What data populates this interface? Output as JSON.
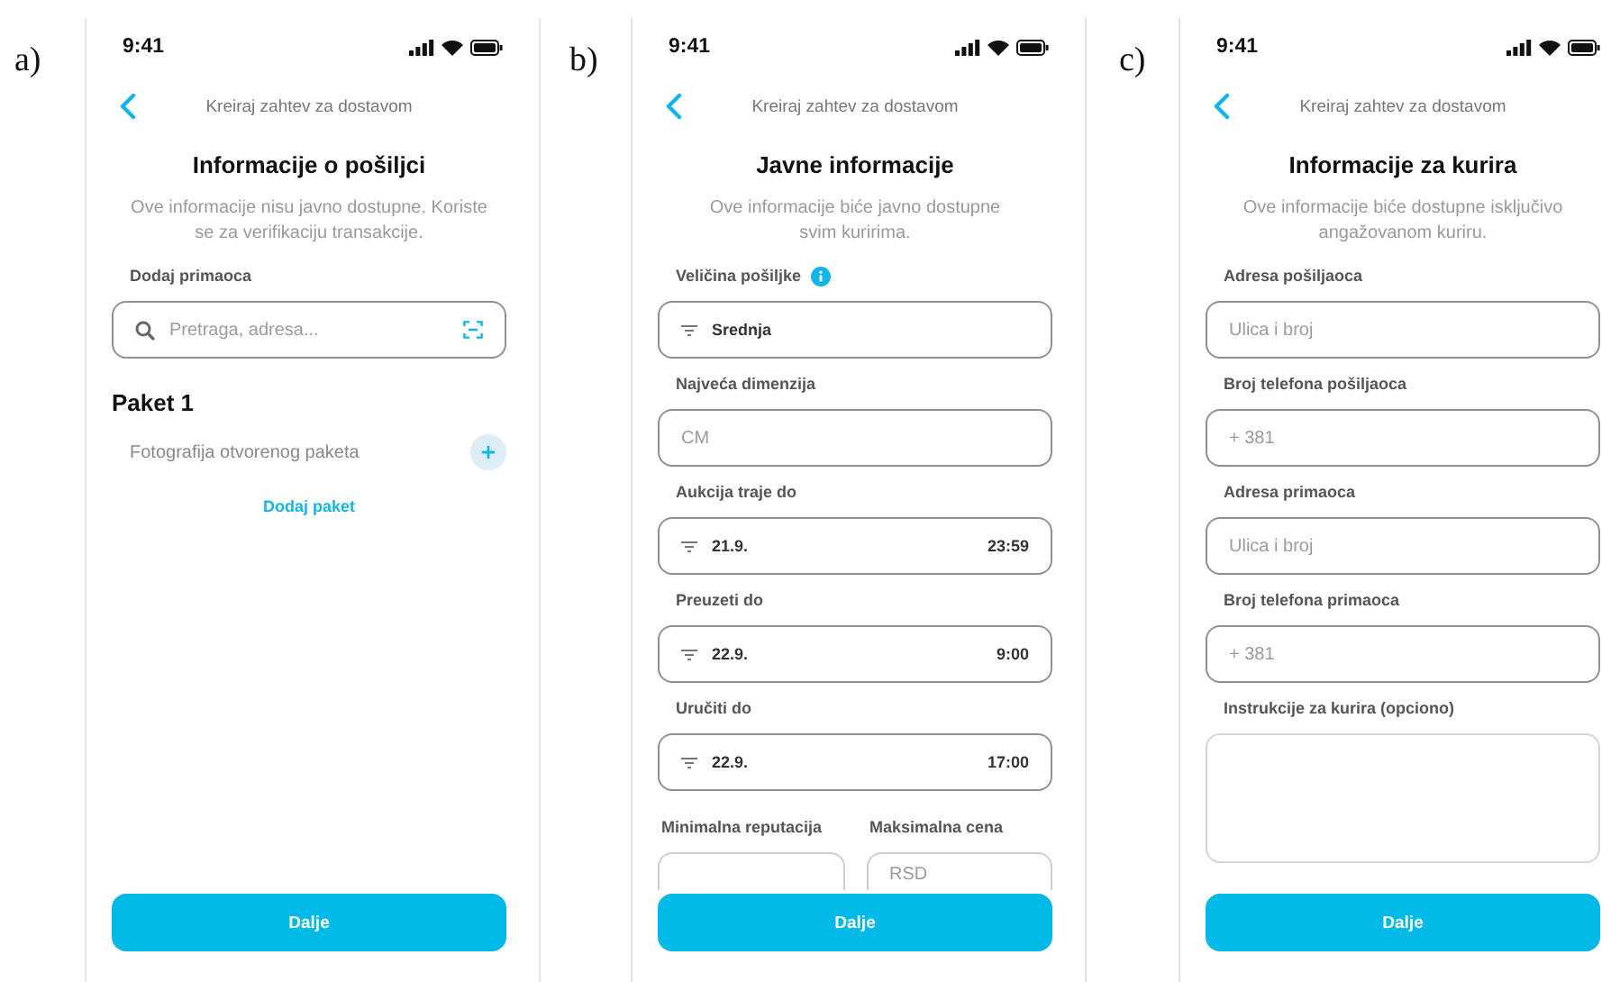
{
  "panels": [
    {
      "label": "a)",
      "screen": {
        "time": "9:41",
        "header": "Kreiraj zahtev za dostavom",
        "title": "Informacije o pošiljci",
        "subtitle": "Ove informacije nisu javno dostupne. Koriste se za verifikaciju transakcije.",
        "content": [
          {
            "kind": "label",
            "text": "Dodaj primaoca"
          },
          {
            "kind": "search",
            "placeholder": "Pretraga, adresa..."
          },
          {
            "kind": "heading",
            "text": "Paket 1"
          },
          {
            "kind": "photo_row",
            "text": "Fotografija otvorenog paketa"
          },
          {
            "kind": "link",
            "text": "Dodaj paket"
          }
        ],
        "button": "Dalje"
      }
    },
    {
      "label": "b)",
      "screen": {
        "time": "9:41",
        "header": "Kreiraj zahtev za dostavom",
        "title": "Javne informacije",
        "subtitle": "Ove informacije biće javno dostupne svim kuririma.",
        "content": [
          {
            "kind": "label",
            "text": "Veličina pošiljke",
            "info": true
          },
          {
            "kind": "select",
            "value": "Srednja"
          },
          {
            "kind": "label",
            "text": "Najveća dimenzija"
          },
          {
            "kind": "input",
            "placeholder": "CM"
          },
          {
            "kind": "label",
            "text": "Aukcija traje do"
          },
          {
            "kind": "select",
            "value": "21.9.",
            "trailing": "23:59"
          },
          {
            "kind": "label",
            "text": "Preuzeti do"
          },
          {
            "kind": "select",
            "value": "22.9.",
            "trailing": "9:00"
          },
          {
            "kind": "label",
            "text": "Uručiti do"
          },
          {
            "kind": "select",
            "value": "22.9.",
            "trailing": "17:00"
          },
          {
            "kind": "pair",
            "items": [
              {
                "label": "Minimalna reputacija"
              },
              {
                "label": "Maksimalna cena",
                "placeholder": "RSD"
              }
            ]
          }
        ],
        "button": "Dalje"
      }
    },
    {
      "label": "c)",
      "screen": {
        "time": "9:41",
        "header": "Kreiraj zahtev za dostavom",
        "title": "Informacije za kurira",
        "subtitle": "Ove informacije biće dostupne isključivo angažovanom kuriru.",
        "content": [
          {
            "kind": "label",
            "text": "Adresa pošiljaoca"
          },
          {
            "kind": "input",
            "placeholder": "Ulica i broj"
          },
          {
            "kind": "label",
            "text": "Broj telefona pošiljaoca"
          },
          {
            "kind": "input",
            "placeholder": "+ 381"
          },
          {
            "kind": "label",
            "text": "Adresa primaoca"
          },
          {
            "kind": "input",
            "placeholder": "Ulica i broj"
          },
          {
            "kind": "label",
            "text": "Broj telefona primaoca"
          },
          {
            "kind": "input",
            "placeholder": "+ 381"
          },
          {
            "kind": "label",
            "text": "Instrukcije za kurira (opciono)"
          },
          {
            "kind": "textarea"
          }
        ],
        "button": "Dalje"
      }
    }
  ]
}
